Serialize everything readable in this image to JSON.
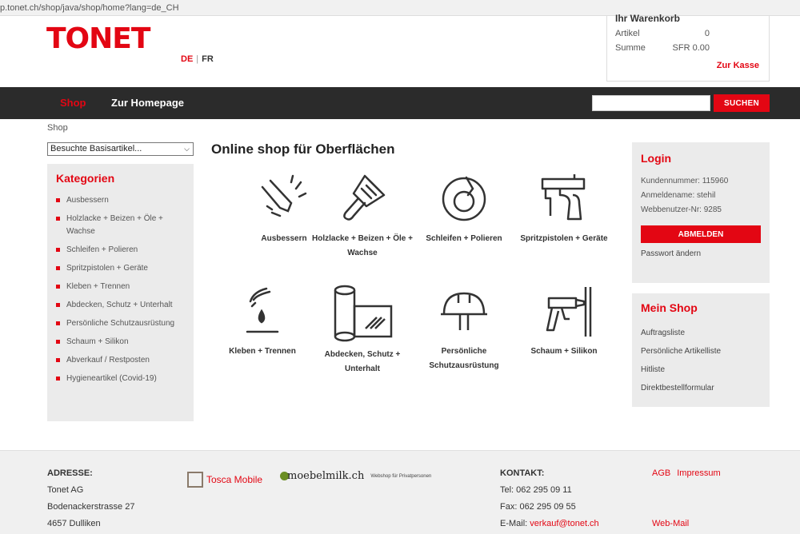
{
  "browser": {
    "url": "p.tonet.ch/shop/java/shop/home?lang=de_CH"
  },
  "header": {
    "logo": "TONET",
    "lang_de": "DE",
    "lang_sep": "|",
    "lang_fr": "FR"
  },
  "cart": {
    "title": "Ihr Warenkorb",
    "items_label": "Artikel",
    "items_value": "0",
    "total_label": "Summe",
    "total_value": "SFR 0.00",
    "checkout_link": "Zur Kasse"
  },
  "nav": {
    "shop": "Shop",
    "homepage": "Zur Homepage",
    "search_value": "",
    "search_button": "SUCHEN"
  },
  "breadcrumb": "Shop",
  "visited_select": "Besuchte Basisartikel...",
  "categories": {
    "title": "Kategorien",
    "items": [
      "Ausbessern",
      "Holzlacke + Beizen + Öle + Wachse",
      "Schleifen + Polieren",
      "Spritzpistolen + Geräte",
      "Kleben + Trennen",
      "Abdecken, Schutz + Unterhalt",
      "Persönliche Schutzausrüstung",
      "Schaum + Silikon",
      "Abverkauf / Restposten",
      "Hygieneartikel (Covid-19)"
    ]
  },
  "main": {
    "title": "Online shop für Oberflächen",
    "products": [
      {
        "label": "Ausbessern",
        "icon": "repair-icon"
      },
      {
        "label": "Holzlacke + Beizen + Öle + Wachse",
        "icon": "brush-icon"
      },
      {
        "label": "Schleifen + Polieren",
        "icon": "sander-icon"
      },
      {
        "label": "Spritzpistolen + Geräte",
        "icon": "spray-gun-icon"
      },
      {
        "label": "Kleben + Trennen",
        "icon": "glue-icon"
      },
      {
        "label": "Abdecken, Schutz + Unterhalt",
        "icon": "cover-roll-icon"
      },
      {
        "label": "Persönliche Schutzausrüstung",
        "icon": "helmet-icon"
      },
      {
        "label": "Schaum + Silikon",
        "icon": "caulk-gun-icon"
      }
    ]
  },
  "login": {
    "title": "Login",
    "customer_number": "Kundennummer: 115960",
    "login_name": "Anmeldename: stehil",
    "web_user": "Webbenutzer-Nr: 9285",
    "logout_button": "ABMELDEN",
    "change_password": "Passwort ändern"
  },
  "myshop": {
    "title": "Mein Shop",
    "items": [
      "Auftragsliste",
      "Persönliche Artikelliste",
      "Hitliste",
      "Direktbestellformular"
    ]
  },
  "footer": {
    "address_title": "ADRESSE:",
    "company": "Tonet AG",
    "street": "Bodenackerstrasse 27",
    "city": "4657 Dulliken",
    "tosca": "Tosca Mobile",
    "moebelmilk": "moebelmilk.ch",
    "moebelmilk_sub": "Webshop für Privatpersonen",
    "contact_title": "KONTAKT:",
    "phone": "Tel: 062 295 09 11",
    "fax": "Fax: 062 295 09 55",
    "email_label": "E-Mail:",
    "email": "verkauf@tonet.ch",
    "agb": "AGB",
    "impressum": "Impressum",
    "webmail": "Web-Mail"
  }
}
